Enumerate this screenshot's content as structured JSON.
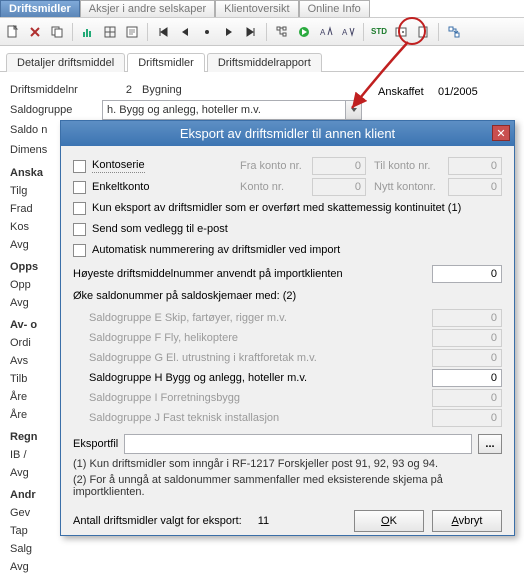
{
  "topnav": {
    "tabs": [
      "Driftsmidler",
      "Aksjer i andre selskaper",
      "Klientoversikt",
      "Online Info"
    ],
    "active": 0
  },
  "formtabs": {
    "tabs": [
      "Detaljer driftsmiddel",
      "Driftsmidler",
      "Driftsmiddelrapport"
    ],
    "active": 1
  },
  "form": {
    "labels": {
      "driftsmiddelnr": "Driftsmiddelnr",
      "saldogruppe": "Saldogruppe",
      "saldo": "Saldo n",
      "dimens": "Dimens"
    },
    "driftsmiddelnr": "2",
    "bygning": "Bygning",
    "saldogruppe": "h. Bygg og anlegg, hoteller m.v.",
    "anskaffet_label": "Anskaffet",
    "anskaffet_value": "01/2005"
  },
  "side_labels": {
    "groups": [
      {
        "hdr": "Anska",
        "items": [
          "Tilg",
          "Frad",
          "Kos",
          "Avg"
        ]
      },
      {
        "hdr": "Opps",
        "items": [
          "Opp",
          "Avg"
        ]
      },
      {
        "hdr": "Av- o",
        "items": [
          "Ordi",
          "Avs",
          "Tilb",
          "Åre",
          "Åre"
        ]
      },
      {
        "hdr": "Regn",
        "items": [
          "IB /",
          "Avg"
        ]
      },
      {
        "hdr": "Andr",
        "items": [
          "Gev",
          "Tap",
          "Salg",
          "Avg"
        ]
      }
    ]
  },
  "modal": {
    "title": "Eksport av driftsmidler til annen klient",
    "checks": {
      "kontoserie": "Kontoserie",
      "enkeltkonto": "Enkeltkonto",
      "kun_eksport": "Kun eksport av driftsmidler som er overført med skattemessig kontinuitet (1)",
      "send_vedlegg": "Send som vedlegg til e-post",
      "auto_num": "Automatisk nummerering av driftsmidler ved import"
    },
    "inline": {
      "fra_konto": "Fra konto nr.",
      "til_konto": "Til konto nr.",
      "konto_nr": "Konto nr.",
      "nytt_konto": "Nytt kontonr.",
      "zero": "0"
    },
    "hoyeste": "Høyeste driftsmiddelnummer anvendt på importklienten",
    "hoyeste_val": "0",
    "oke": "Øke saldonummer på saldoskjemaer med: (2)",
    "groups": [
      {
        "label": "Saldogruppe E Skip, fartøyer, rigger m.v.",
        "val": "0",
        "enabled": false
      },
      {
        "label": "Saldogruppe F Fly, helikoptere",
        "val": "0",
        "enabled": false
      },
      {
        "label": "Saldogruppe G El. utrustning i kraftforetak m.v.",
        "val": "0",
        "enabled": false
      },
      {
        "label": "Saldogruppe H Bygg og anlegg, hoteller m.v.",
        "val": "0",
        "enabled": true
      },
      {
        "label": "Saldogruppe I Forretningsbygg",
        "val": "0",
        "enabled": false
      },
      {
        "label": "Saldogruppe J Fast teknisk installasjon",
        "val": "0",
        "enabled": false
      }
    ],
    "eksportfil_label": "Eksportfil",
    "browse": "...",
    "note1": "(1) Kun driftsmidler som inngår i RF-1217 Forskjeller post 91, 92, 93 og 94.",
    "note2": "(2) For å unngå at saldonummer sammenfaller med eksisterende skjema på importklienten.",
    "antall_label": "Antall driftsmidler valgt for eksport:",
    "antall_value": "11",
    "ok_u": "O",
    "ok_rest": "K",
    "avbryt_u": "A",
    "avbryt_rest": "vbryt"
  }
}
